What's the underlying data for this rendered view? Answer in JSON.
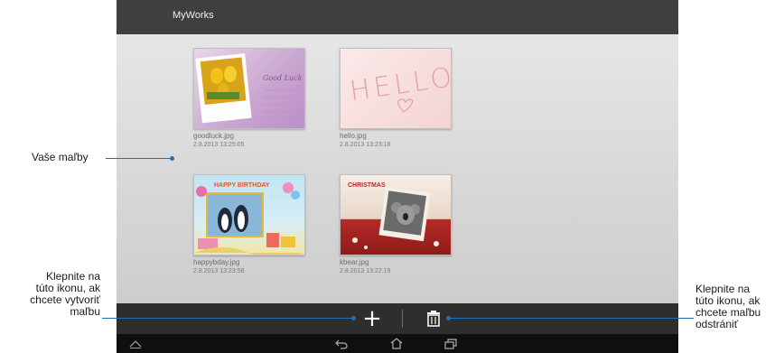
{
  "app": {
    "title": "MyWorks"
  },
  "items": [
    {
      "name": "goodluck.jpg",
      "date": "2.8.2013 13:25:05",
      "card_text": "Good Luck"
    },
    {
      "name": "hello.jpg",
      "date": "2.8.2013 13:23:18",
      "card_text": "HELLO"
    },
    {
      "name": "happybday.jpg",
      "date": "2.8.2013 13:23:58",
      "card_text": "HAPPY BIRTHDAY"
    },
    {
      "name": "kbear.jpg",
      "date": "2.8.2013 13:22:19",
      "card_text": "CHRISTMAS"
    }
  ],
  "callouts": {
    "paintings": "Vaše maľby",
    "create": [
      "Klepnite na",
      "túto ikonu, ak",
      "chcete vytvoriť",
      "maľbu"
    ],
    "delete": [
      "Klepnite na",
      "túto ikonu, ak",
      "chcete maľbu",
      "odstrániť"
    ]
  },
  "icons": {
    "add": "+",
    "delete": "trash-icon",
    "back": "back-icon",
    "home": "home-icon",
    "recents": "recent-apps-icon",
    "up": "chevron-up-icon"
  },
  "colors": {
    "callout_line": "#1d6fb8",
    "titlebar": "#3f3f3f",
    "actionbar": "#2e2e2e"
  }
}
